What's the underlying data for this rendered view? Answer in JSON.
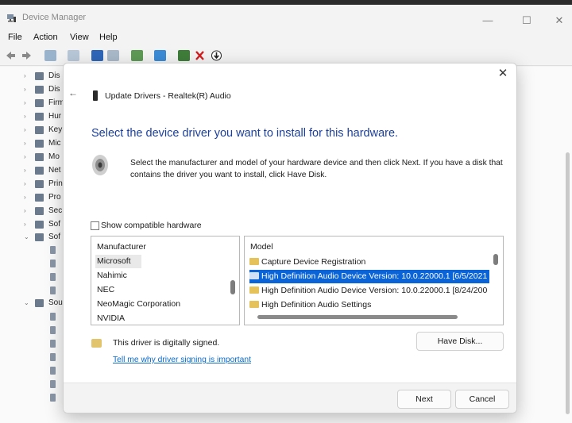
{
  "window": {
    "title": "Device Manager",
    "controls": {
      "minimize": "—",
      "maximize": "☐",
      "close": "✕"
    }
  },
  "menu": [
    "File",
    "Action",
    "View",
    "Help"
  ],
  "tree": {
    "items": [
      {
        "label": "Dis",
        "expander": "›"
      },
      {
        "label": "Dis",
        "expander": "›"
      },
      {
        "label": "Firm",
        "expander": "›"
      },
      {
        "label": "Hur",
        "expander": "›"
      },
      {
        "label": "Key",
        "expander": "›"
      },
      {
        "label": "Mic",
        "expander": "›"
      },
      {
        "label": "Mo",
        "expander": "›"
      },
      {
        "label": "Net",
        "expander": "›"
      },
      {
        "label": "Prin",
        "expander": "›"
      },
      {
        "label": "Pro",
        "expander": "›"
      },
      {
        "label": "Sec",
        "expander": "›"
      },
      {
        "label": "Sof",
        "expander": "›"
      },
      {
        "label": "Sof",
        "expander": "⌄"
      },
      {
        "label": "Sou",
        "expander": "⌄"
      }
    ]
  },
  "dialog": {
    "close": "✕",
    "back": "←",
    "title": "Update Drivers - Realtek(R) Audio",
    "heading": "Select the device driver you want to install for this hardware.",
    "description": "Select the manufacturer and model of your hardware device and then click Next. If you have a disk that contains the driver you want to install, click Have Disk.",
    "show_compatible": {
      "label": "Show compatible hardware",
      "checked": false
    },
    "manufacturer": {
      "header": "Manufacturer",
      "items": [
        "Microsoft",
        "Nahimic",
        "NEC",
        "NeoMagic Corporation",
        "NVIDIA"
      ],
      "selected_index": 0
    },
    "model": {
      "header": "Model",
      "items": [
        "Capture Device Registration",
        "High Definition Audio Device Version: 10.0.22000.1 [6/5/2021",
        "High Definition Audio Device Version: 10.0.22000.1 [8/24/200",
        "High Definition Audio Settings"
      ],
      "selected_index": 1
    },
    "signed_text": "This driver is digitally signed.",
    "signing_link": "Tell me why driver signing is important",
    "have_disk": "Have Disk...",
    "next": "Next",
    "cancel": "Cancel"
  },
  "colors": {
    "heading": "#1c3f9b",
    "selection": "#0a64d8",
    "link": "#0b6bc9"
  }
}
